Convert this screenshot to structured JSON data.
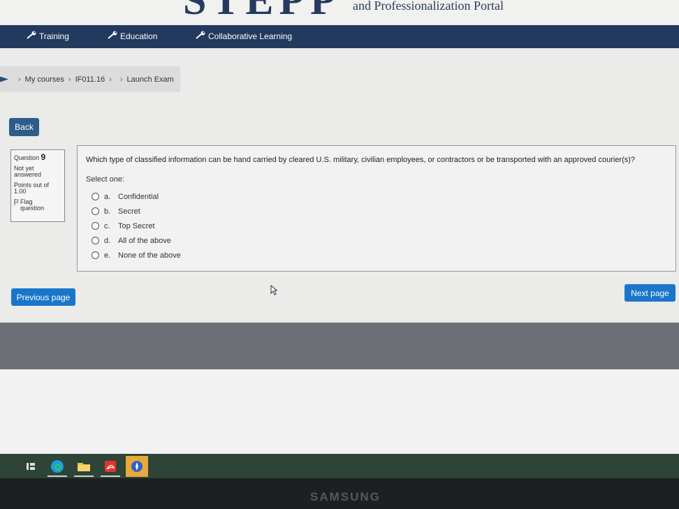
{
  "header": {
    "logo_text": "STEPP",
    "portal_subtitle": "and Professionalization Portal"
  },
  "nav": {
    "items": [
      {
        "label": "Training",
        "icon": "wrench-icon"
      },
      {
        "label": "Education",
        "icon": "wrench-icon"
      },
      {
        "label": "Collaborative Learning",
        "icon": "wrench-icon"
      }
    ]
  },
  "breadcrumb": {
    "items": [
      "My courses",
      "IF011.16",
      "Launch Exam"
    ]
  },
  "back_button": "Back",
  "question_info": {
    "label": "Question",
    "number": "9",
    "status_line1": "Not yet",
    "status_line2": "answered",
    "points_line1": "Points out of",
    "points_line2": "1.00",
    "flag_line1": "Flag",
    "flag_line2": "question"
  },
  "question": {
    "text": "Which type of classified information can be hand carried by cleared U.S. military, civilian employees, or contractors or be transported with an approved courier(s)?",
    "select_one": "Select one:",
    "options": [
      {
        "letter": "a.",
        "text": "Confidential"
      },
      {
        "letter": "b.",
        "text": "Secret"
      },
      {
        "letter": "c.",
        "text": "Top Secret"
      },
      {
        "letter": "d.",
        "text": "All of the above"
      },
      {
        "letter": "e.",
        "text": "None of the above"
      }
    ]
  },
  "buttons": {
    "previous": "Previous page",
    "next": "Next page"
  },
  "monitor": {
    "brand": "SAMSUNG"
  }
}
